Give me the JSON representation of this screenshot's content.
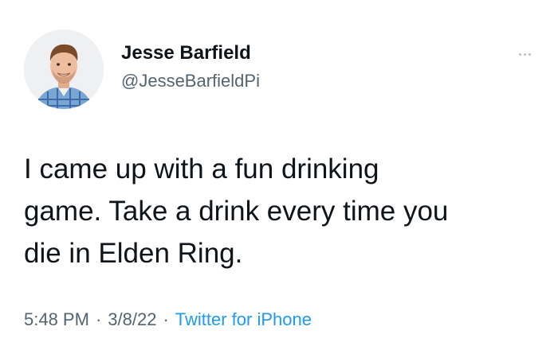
{
  "author": {
    "name": "Jesse Barfield",
    "handle": "@JesseBarfieldPi",
    "avatar": "profile-photo"
  },
  "more_icon": "more-horizontal-icon",
  "tweet": {
    "text": "I came up with a fun drinking\ngame. Take a drink every time you\ndie in Elden Ring."
  },
  "meta": {
    "time": "5:48 PM",
    "separator": "·",
    "date": "3/8/22",
    "client": "Twitter for iPhone"
  },
  "colors": {
    "text": "#0f1419",
    "secondary": "#536471",
    "link": "#1d9bf0"
  }
}
